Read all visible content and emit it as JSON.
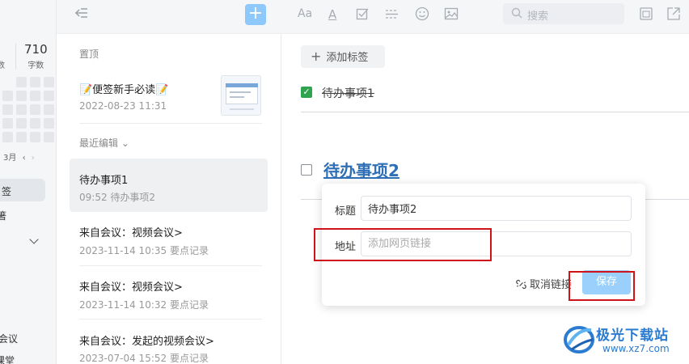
{
  "sidebar": {
    "stat_value": "710",
    "stat_label": "字数",
    "stat_prev_label": "数",
    "month_label": "3月",
    "nav_prev": "‹",
    "nav_next": "›",
    "nav_items": [
      "签",
      "箸",
      "会议",
      "课堂"
    ]
  },
  "list": {
    "pinned_label": "置顶",
    "recent_label": "最近编辑 ⌄",
    "pinned_note": {
      "title": "📝便签新手必读📝",
      "date": "2022-08-23 11:31"
    },
    "notes": [
      {
        "title": "待办事项1",
        "sub": "09:52 待办事项2"
      },
      {
        "title": "来自会议：视频会议>",
        "sub": "2023-11-14 10:35 要点记录"
      },
      {
        "title": "来自会议：视频会议>",
        "sub": "2023-11-14 10:32 要点记录"
      },
      {
        "title": "来自会议：发起的视频会议>",
        "sub": "2023-07-04 15:52 要点记录"
      }
    ],
    "add_label": "+"
  },
  "toolbar": {
    "font_size_icon": "Aa",
    "font_color_icon": "A",
    "search_placeholder": "搜索"
  },
  "editor": {
    "add_tag_label": "添加标签",
    "todo1": "待办事项1",
    "todo2": "待办事项2"
  },
  "link_popup": {
    "title_label": "标题",
    "title_value": "待办事项2",
    "url_label": "地址",
    "url_placeholder": "添加网页链接",
    "unlink_label": "取消链接",
    "save_label": "保存"
  },
  "watermark": {
    "name": "极光下载站",
    "url": "www.xz7.com"
  },
  "colors": {
    "accent": "#8fc8fb",
    "link": "#2f6fb6",
    "check": "#2ea44f",
    "highlight_box": "#d0121b"
  }
}
